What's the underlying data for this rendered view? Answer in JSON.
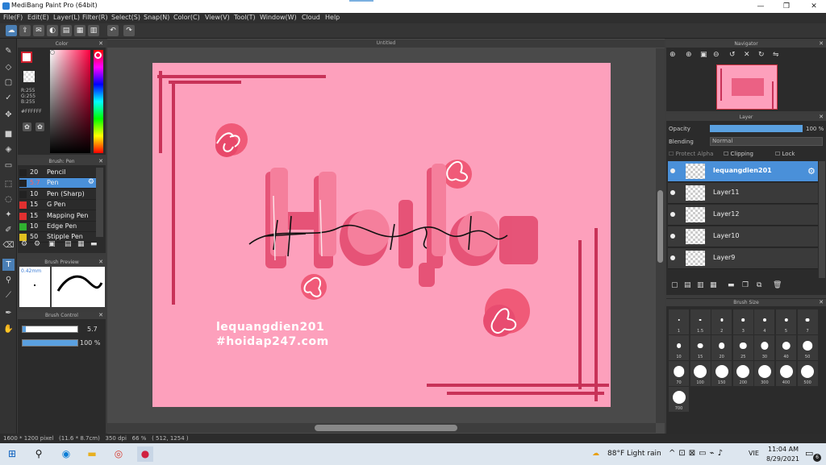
{
  "window": {
    "title": "MediBang Paint Pro (64bit)",
    "min": "—",
    "max": "❐",
    "close": "✕"
  },
  "menu": [
    "File(F)",
    "Edit(E)",
    "Layer(L)",
    "Filter(R)",
    "Select(S)",
    "Snap(N)",
    "Color(C)",
    "View(V)",
    "Tool(T)",
    "Window(W)",
    "Cloud",
    "Help"
  ],
  "document": {
    "tab_title": "Untitled"
  },
  "color_panel": {
    "title": "Color",
    "r": "R:255",
    "g": "G:255",
    "b": "B:255",
    "hex": "#FFFFFF"
  },
  "brush_panel": {
    "title": "Brush: Pen",
    "items": [
      {
        "size": "20",
        "name": "Pencil",
        "color": "#222222"
      },
      {
        "size": "5.7",
        "name": "Pen",
        "color": "#222222"
      },
      {
        "size": "10",
        "name": "Pen (Sharp)",
        "color": "#222222"
      },
      {
        "size": "15",
        "name": "G Pen",
        "color": "#e03030"
      },
      {
        "size": "15",
        "name": "Mapping Pen",
        "color": "#e03030"
      },
      {
        "size": "10",
        "name": "Edge Pen",
        "color": "#30b030"
      },
      {
        "size": "50",
        "name": "Stipple Pen",
        "color": "#e0c020"
      }
    ]
  },
  "brush_preview": {
    "title": "Brush Preview",
    "size_label": "0.42mm"
  },
  "brush_control": {
    "title": "Brush Control",
    "size_value": "5.7",
    "opacity_value": "100 %",
    "size_fraction": 0.06,
    "opacity_fraction": 1.0
  },
  "canvas_text": {
    "line1": "lequangdien201",
    "line2": "#hoidap247.com"
  },
  "status_bar": {
    "text": "1600 * 1200 pixel   (11.6 * 8.7cm)   350 dpi   66 %   ( 512, 1254 )"
  },
  "navigator": {
    "title": "Navigator"
  },
  "layer_panel": {
    "title": "Layer",
    "opacity_label": "Opacity",
    "opacity_value": "100 %",
    "blending_label": "Blending",
    "blending_value": "Normal",
    "protect_alpha": "Protect Alpha",
    "clipping": "Clipping",
    "lock": "Lock",
    "layers": [
      {
        "name": "lequangdien201",
        "selected": true
      },
      {
        "name": "Layer11",
        "selected": false
      },
      {
        "name": "Layer12",
        "selected": false
      },
      {
        "name": "Layer10",
        "selected": false
      },
      {
        "name": "Layer9",
        "selected": false
      }
    ]
  },
  "brush_size_panel": {
    "title": "Brush Size",
    "sizes": [
      "1",
      "1.5",
      "2",
      "3",
      "4",
      "5",
      "7",
      "10",
      "15",
      "20",
      "25",
      "30",
      "40",
      "50",
      "70",
      "100",
      "150",
      "200",
      "300",
      "400",
      "500",
      "700"
    ]
  },
  "taskbar": {
    "weather": "88°F  Light rain",
    "lang": "VIE",
    "time": "11:04 AM",
    "date": "8/29/2021",
    "notif_count": "6"
  }
}
